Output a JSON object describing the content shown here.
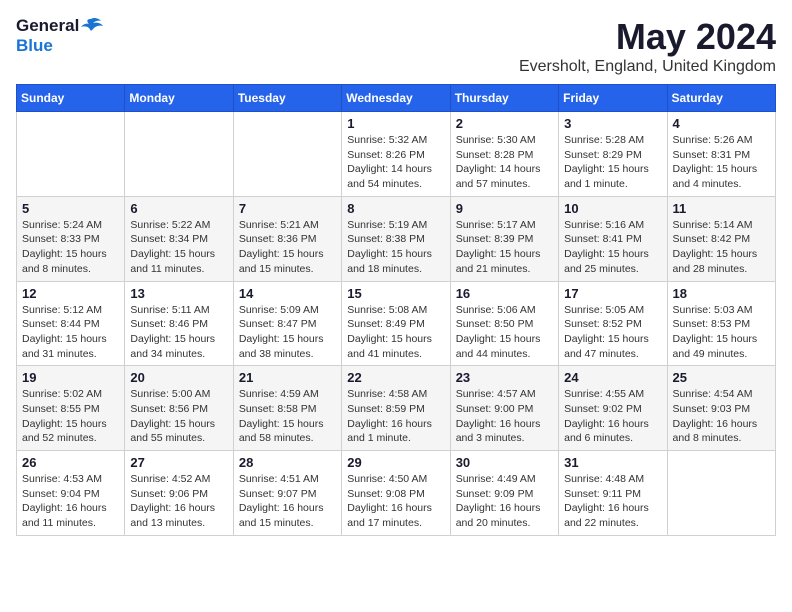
{
  "header": {
    "logo_general": "General",
    "logo_blue": "Blue",
    "month": "May 2024",
    "location": "Eversholt, England, United Kingdom"
  },
  "weekdays": [
    "Sunday",
    "Monday",
    "Tuesday",
    "Wednesday",
    "Thursday",
    "Friday",
    "Saturday"
  ],
  "weeks": [
    [
      {
        "day": "",
        "info": ""
      },
      {
        "day": "",
        "info": ""
      },
      {
        "day": "",
        "info": ""
      },
      {
        "day": "1",
        "info": "Sunrise: 5:32 AM\nSunset: 8:26 PM\nDaylight: 14 hours\nand 54 minutes."
      },
      {
        "day": "2",
        "info": "Sunrise: 5:30 AM\nSunset: 8:28 PM\nDaylight: 14 hours\nand 57 minutes."
      },
      {
        "day": "3",
        "info": "Sunrise: 5:28 AM\nSunset: 8:29 PM\nDaylight: 15 hours\nand 1 minute."
      },
      {
        "day": "4",
        "info": "Sunrise: 5:26 AM\nSunset: 8:31 PM\nDaylight: 15 hours\nand 4 minutes."
      }
    ],
    [
      {
        "day": "5",
        "info": "Sunrise: 5:24 AM\nSunset: 8:33 PM\nDaylight: 15 hours\nand 8 minutes."
      },
      {
        "day": "6",
        "info": "Sunrise: 5:22 AM\nSunset: 8:34 PM\nDaylight: 15 hours\nand 11 minutes."
      },
      {
        "day": "7",
        "info": "Sunrise: 5:21 AM\nSunset: 8:36 PM\nDaylight: 15 hours\nand 15 minutes."
      },
      {
        "day": "8",
        "info": "Sunrise: 5:19 AM\nSunset: 8:38 PM\nDaylight: 15 hours\nand 18 minutes."
      },
      {
        "day": "9",
        "info": "Sunrise: 5:17 AM\nSunset: 8:39 PM\nDaylight: 15 hours\nand 21 minutes."
      },
      {
        "day": "10",
        "info": "Sunrise: 5:16 AM\nSunset: 8:41 PM\nDaylight: 15 hours\nand 25 minutes."
      },
      {
        "day": "11",
        "info": "Sunrise: 5:14 AM\nSunset: 8:42 PM\nDaylight: 15 hours\nand 28 minutes."
      }
    ],
    [
      {
        "day": "12",
        "info": "Sunrise: 5:12 AM\nSunset: 8:44 PM\nDaylight: 15 hours\nand 31 minutes."
      },
      {
        "day": "13",
        "info": "Sunrise: 5:11 AM\nSunset: 8:46 PM\nDaylight: 15 hours\nand 34 minutes."
      },
      {
        "day": "14",
        "info": "Sunrise: 5:09 AM\nSunset: 8:47 PM\nDaylight: 15 hours\nand 38 minutes."
      },
      {
        "day": "15",
        "info": "Sunrise: 5:08 AM\nSunset: 8:49 PM\nDaylight: 15 hours\nand 41 minutes."
      },
      {
        "day": "16",
        "info": "Sunrise: 5:06 AM\nSunset: 8:50 PM\nDaylight: 15 hours\nand 44 minutes."
      },
      {
        "day": "17",
        "info": "Sunrise: 5:05 AM\nSunset: 8:52 PM\nDaylight: 15 hours\nand 47 minutes."
      },
      {
        "day": "18",
        "info": "Sunrise: 5:03 AM\nSunset: 8:53 PM\nDaylight: 15 hours\nand 49 minutes."
      }
    ],
    [
      {
        "day": "19",
        "info": "Sunrise: 5:02 AM\nSunset: 8:55 PM\nDaylight: 15 hours\nand 52 minutes."
      },
      {
        "day": "20",
        "info": "Sunrise: 5:00 AM\nSunset: 8:56 PM\nDaylight: 15 hours\nand 55 minutes."
      },
      {
        "day": "21",
        "info": "Sunrise: 4:59 AM\nSunset: 8:58 PM\nDaylight: 15 hours\nand 58 minutes."
      },
      {
        "day": "22",
        "info": "Sunrise: 4:58 AM\nSunset: 8:59 PM\nDaylight: 16 hours\nand 1 minute."
      },
      {
        "day": "23",
        "info": "Sunrise: 4:57 AM\nSunset: 9:00 PM\nDaylight: 16 hours\nand 3 minutes."
      },
      {
        "day": "24",
        "info": "Sunrise: 4:55 AM\nSunset: 9:02 PM\nDaylight: 16 hours\nand 6 minutes."
      },
      {
        "day": "25",
        "info": "Sunrise: 4:54 AM\nSunset: 9:03 PM\nDaylight: 16 hours\nand 8 minutes."
      }
    ],
    [
      {
        "day": "26",
        "info": "Sunrise: 4:53 AM\nSunset: 9:04 PM\nDaylight: 16 hours\nand 11 minutes."
      },
      {
        "day": "27",
        "info": "Sunrise: 4:52 AM\nSunset: 9:06 PM\nDaylight: 16 hours\nand 13 minutes."
      },
      {
        "day": "28",
        "info": "Sunrise: 4:51 AM\nSunset: 9:07 PM\nDaylight: 16 hours\nand 15 minutes."
      },
      {
        "day": "29",
        "info": "Sunrise: 4:50 AM\nSunset: 9:08 PM\nDaylight: 16 hours\nand 17 minutes."
      },
      {
        "day": "30",
        "info": "Sunrise: 4:49 AM\nSunset: 9:09 PM\nDaylight: 16 hours\nand 20 minutes."
      },
      {
        "day": "31",
        "info": "Sunrise: 4:48 AM\nSunset: 9:11 PM\nDaylight: 16 hours\nand 22 minutes."
      },
      {
        "day": "",
        "info": ""
      }
    ]
  ]
}
